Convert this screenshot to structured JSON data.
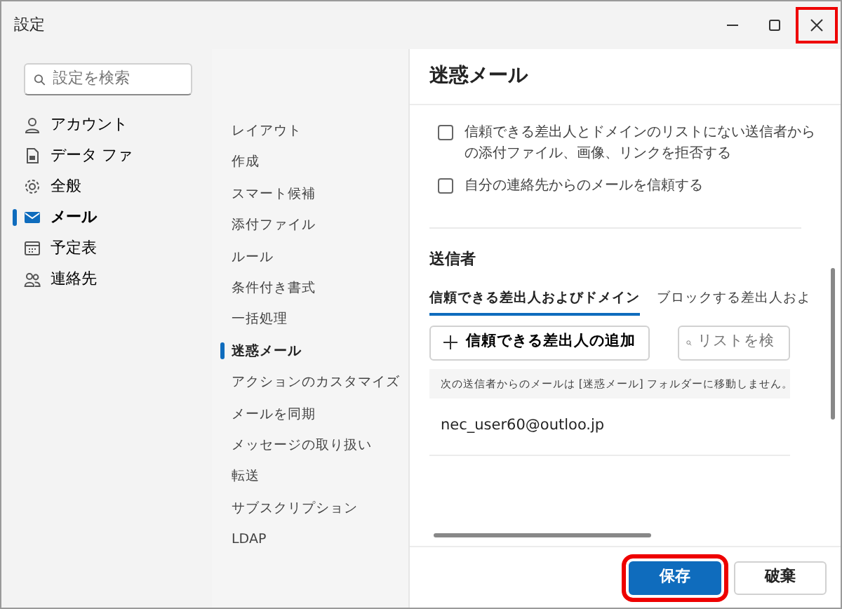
{
  "window": {
    "title": "設定",
    "controls": [
      {
        "kind": "minimize",
        "highlighted": false
      },
      {
        "kind": "maximize",
        "highlighted": false
      },
      {
        "kind": "close",
        "highlighted": true
      }
    ]
  },
  "sidebar": {
    "search": {
      "placeholder": "設定を検索"
    },
    "items": [
      {
        "label": "アカウント",
        "selected": false
      },
      {
        "label": "データ ファ",
        "selected": false
      },
      {
        "label": "全般",
        "selected": false
      },
      {
        "label": "メール",
        "selected": true
      },
      {
        "label": "予定表",
        "selected": false
      },
      {
        "label": "連絡先",
        "selected": false
      }
    ]
  },
  "subnav": {
    "items": [
      {
        "label": "レイアウト",
        "selected": false
      },
      {
        "label": "作成",
        "selected": false
      },
      {
        "label": "スマート候補",
        "selected": false
      },
      {
        "label": "添付ファイル",
        "selected": false
      },
      {
        "label": "ルール",
        "selected": false
      },
      {
        "label": "条件付き書式",
        "selected": false
      },
      {
        "label": "一括処理",
        "selected": false
      },
      {
        "label": "迷惑メール",
        "selected": true
      },
      {
        "label": "アクションのカスタマイズ",
        "selected": false
      },
      {
        "label": "メールを同期",
        "selected": false
      },
      {
        "label": "メッセージの取り扱い",
        "selected": false
      },
      {
        "label": "転送",
        "selected": false
      },
      {
        "label": "サブスクリプション",
        "selected": false
      },
      {
        "label": "LDAP",
        "selected": false
      }
    ]
  },
  "panel": {
    "title": "迷惑メール",
    "options": [
      {
        "label": "信頼できる差出人とドメインのリストにない送信者からの添付ファイル、画像、リンクを拒否する",
        "checked": false
      },
      {
        "label": "自分の連絡先からのメールを信頼する",
        "checked": false
      }
    ],
    "senders": {
      "heading": "送信者",
      "tabs": [
        {
          "label": "信頼できる差出人およびドメイン",
          "selected": true
        },
        {
          "label": "ブロックする差出人およ",
          "selected": false
        }
      ],
      "add_button": "信頼できる差出人の追加",
      "search": {
        "placeholder": "リストを検"
      },
      "info": "次の送信者からのメールは [迷惑メール] フォルダーに移動しません。",
      "entries": [
        "nec_user60@outloo.jp"
      ]
    }
  },
  "footer": {
    "buttons": [
      {
        "label": "保存",
        "kind": "primary",
        "highlighted": true
      },
      {
        "label": "破棄",
        "kind": "secondary",
        "highlighted": false
      }
    ]
  }
}
